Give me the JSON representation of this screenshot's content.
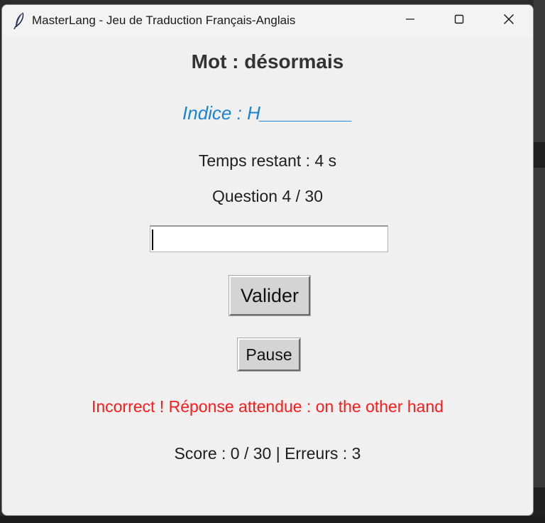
{
  "window": {
    "title": "MasterLang - Jeu de Traduction Français-Anglais",
    "icon": "feather-icon",
    "controls": [
      "minimize-icon",
      "maximize-icon",
      "close-icon"
    ]
  },
  "game": {
    "word": "Mot : désormais",
    "hint": "Indice : H_________",
    "time_left": "Temps restant : 4 s",
    "question": "Question 4 / 30",
    "answer_value": "",
    "validate_label": "Valider",
    "pause_label": "Pause",
    "feedback": "Incorrect ! Réponse attendue : on the other hand",
    "score": "Score : 0 / 30 | Erreurs : 3"
  },
  "colors": {
    "hint": "#1b84d2",
    "feedback_error": "#ff1a1a",
    "window_bg": "#f0f0f0"
  }
}
